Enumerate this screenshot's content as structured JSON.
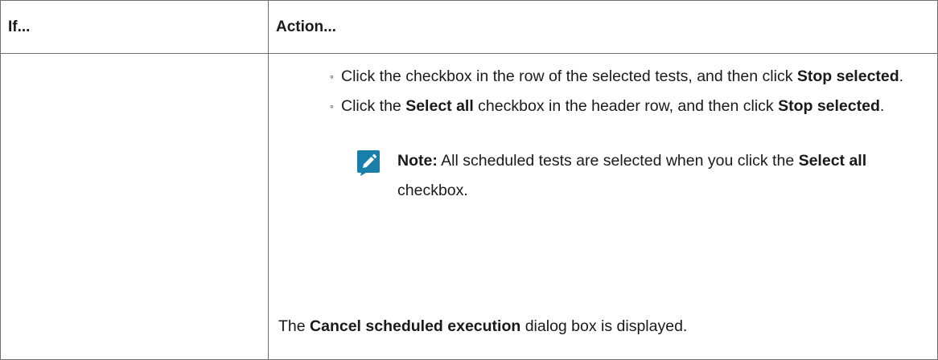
{
  "table": {
    "header": {
      "if_label": "If...",
      "action_label": "Action..."
    },
    "bullets": [
      {
        "pre": "Click the checkbox in the row of the selected tests, and then click ",
        "bold1": "Stop selected",
        "mid": ".",
        "bold2": "",
        "post": ""
      },
      {
        "pre": "Click the ",
        "bold1": "Select all",
        "mid": " checkbox in the header row, and then click ",
        "bold2": "Stop selected",
        "post": "."
      }
    ],
    "bullet_marker": "◦",
    "note": {
      "icon": "pencil-note-icon",
      "icon_color": "#1a7fa8",
      "label": "Note:",
      "text_before": " All scheduled tests are selected when you click the ",
      "bold": "Select all",
      "text_after": " checkbox."
    },
    "result": {
      "pre": "The ",
      "bold": "Cancel scheduled execution",
      "post": " dialog box is displayed."
    }
  }
}
